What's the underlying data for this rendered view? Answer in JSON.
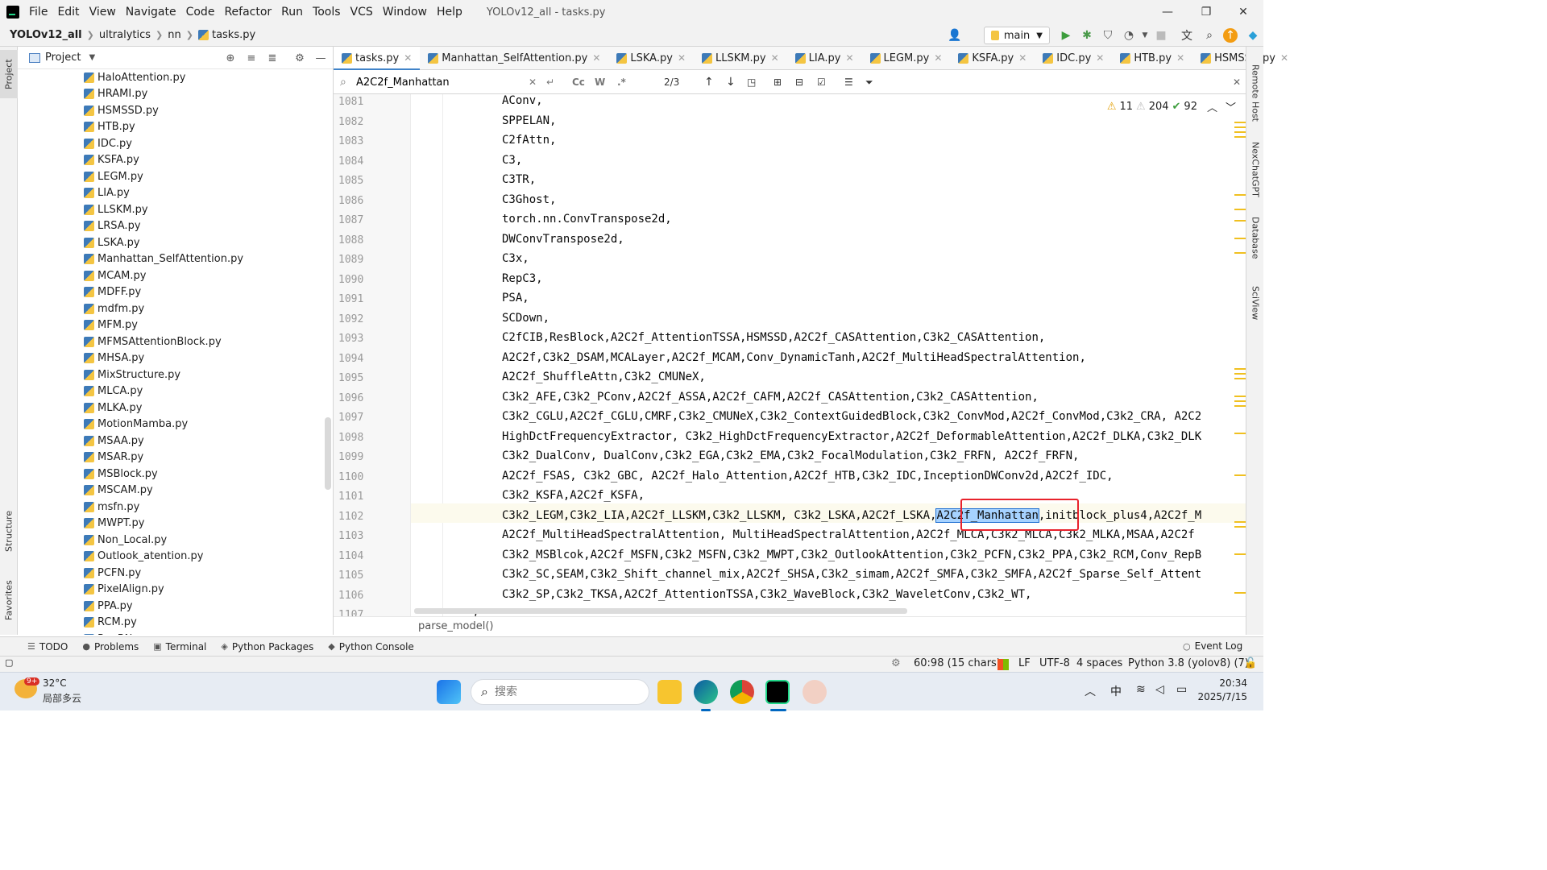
{
  "menubar": {
    "items": [
      "File",
      "Edit",
      "View",
      "Navigate",
      "Code",
      "Refactor",
      "Run",
      "Tools",
      "VCS",
      "Window",
      "Help"
    ],
    "window_title": "YOLOv12_all - tasks.py",
    "minimize": "—",
    "restore": "❐",
    "close": "✕"
  },
  "navbar": {
    "breadcrumb": [
      "YOLOv12_all",
      "ultralytics",
      "nn",
      "tasks.py"
    ],
    "branch": "main"
  },
  "project": {
    "title": "Project",
    "files": [
      "HaloAttention.py",
      "HRAMI.py",
      "HSMSSD.py",
      "HTB.py",
      "IDC.py",
      "KSFA.py",
      "LEGM.py",
      "LIA.py",
      "LLSKM.py",
      "LRSA.py",
      "LSKA.py",
      "Manhattan_SelfAttention.py",
      "MCAM.py",
      "MDFF.py",
      "mdfm.py",
      "MFM.py",
      "MFMSAttentionBlock.py",
      "MHSA.py",
      "MixStructure.py",
      "MLCA.py",
      "MLKA.py",
      "MotionMamba.py",
      "MSAA.py",
      "MSAR.py",
      "MSBlock.py",
      "MSCAM.py",
      "msfn.py",
      "MWPT.py",
      "Non_Local.py",
      "Outlook_atention.py",
      "PCFN.py",
      "PixelAlign.py",
      "PPA.py",
      "RCM.py",
      "RepBN..."
    ]
  },
  "left_stripe": {
    "project": "Project",
    "structure": "Structure",
    "favorites": "Favorites"
  },
  "tabs": [
    "tasks.py",
    "Manhattan_SelfAttention.py",
    "LSKA.py",
    "LLSKM.py",
    "LIA.py",
    "LEGM.py",
    "KSFA.py",
    "IDC.py",
    "HTB.py",
    "HSMSSD.py"
  ],
  "search": {
    "query": "A2C2f_Manhattan",
    "match_case": "Cc",
    "words": "W",
    "regex": ".*",
    "result": "2/3"
  },
  "editor": {
    "inspections": {
      "warnings": "11",
      "weak_warnings": "204",
      "ok": "92"
    },
    "lines": [
      {
        "no": "1081",
        "code": "AConv,"
      },
      {
        "no": "1082",
        "code": "SPPELAN,"
      },
      {
        "no": "1083",
        "code": "C2fAttn,"
      },
      {
        "no": "1084",
        "code": "C3,"
      },
      {
        "no": "1085",
        "code": "C3TR,"
      },
      {
        "no": "1086",
        "code": "C3Ghost,"
      },
      {
        "no": "1087",
        "code": "torch.nn.ConvTranspose2d,"
      },
      {
        "no": "1088",
        "code": "DWConvTranspose2d,"
      },
      {
        "no": "1089",
        "code": "C3x,"
      },
      {
        "no": "1090",
        "code": "RepC3,"
      },
      {
        "no": "1091",
        "code": "PSA,"
      },
      {
        "no": "1092",
        "code": "SCDown,"
      },
      {
        "no": "1093",
        "code": "C2fCIB,ResBlock,A2C2f_AttentionTSSA,HSMSSD,A2C2f_CASAttention,C3k2_CASAttention,"
      },
      {
        "no": "1094",
        "code": "A2C2f,C3k2_DSAM,MCALayer,A2C2f_MCAM,Conv_DynamicTanh,A2C2f_MultiHeadSpectralAttention,"
      },
      {
        "no": "1095",
        "code": "A2C2f_ShuffleAttn,C3k2_CMUNeX,"
      },
      {
        "no": "1096",
        "code": "C3k2_AFE,C3k2_PConv,A2C2f_ASSA,A2C2f_CAFM,A2C2f_CASAttention,C3k2_CASAttention,"
      },
      {
        "no": "1097",
        "code": "C3k2_CGLU,A2C2f_CGLU,CMRF,C3k2_CMUNeX,C3k2_ContextGuidedBlock,C3k2_ConvMod,A2C2f_ConvMod,C3k2_CRA, A2C2"
      },
      {
        "no": "1098",
        "code": "HighDctFrequencyExtractor, C3k2_HighDctFrequencyExtractor,A2C2f_DeformableAttention,A2C2f_DLKA,C3k2_DLK"
      },
      {
        "no": "1099",
        "code": "C3k2_DualConv, DualConv,C3k2_EGA,C3k2_EMA,C3k2_FocalModulation,C3k2_FRFN, A2C2f_FRFN,"
      },
      {
        "no": "1100",
        "code": "A2C2f_FSAS, C3k2_GBC, A2C2f_Halo_Attention,A2C2f_HTB,C3k2_IDC,InceptionDWConv2d,A2C2f_IDC,"
      },
      {
        "no": "1101",
        "code": "C3k2_KSFA,A2C2f_KSFA,"
      },
      {
        "no": "1102",
        "code_before": "C3k2_LEGM,C3k2_LIA,A2C2f_LLSKM,C3k2_LLSKM, C3k2_LSKA,A2C2f_LSKA,",
        "code_match": "A2C2f_Manhattan",
        "code_after": ",initblock_plus4,A2C2f_M"
      },
      {
        "no": "1103",
        "code": "A2C2f_MultiHeadSpectralAttention, MultiHeadSpectralAttention,A2C2f_MLCA,C3k2_MLCA,C3k2_MLKA,MSAA,A2C2f"
      },
      {
        "no": "1104",
        "code": "C3k2_MSBlcok,A2C2f_MSFN,C3k2_MSFN,C3k2_MWPT,C3k2_OutlookAttention,C3k2_PCFN,C3k2_PPA,C3k2_RCM,Conv_RepB"
      },
      {
        "no": "1105",
        "code": "C3k2_SC,SEAM,C3k2_Shift_channel_mix,A2C2f_SHSA,C3k2_simam,A2C2f_SMFA,C3k2_SMFA,A2C2f_Sparse_Self_Attent"
      },
      {
        "no": "1106",
        "code": "C3k2_SP,C3k2_TKSA,A2C2f_AttentionTSSA,C3k2_WaveBlock,C3k2_WaveletConv,C3k2_WT,"
      },
      {
        "no": "1107",
        "code": "}"
      }
    ],
    "method_crumb": "parse_model()"
  },
  "right_stripe": [
    "Remote Host",
    "NexChatGPT",
    "Database",
    "SciView"
  ],
  "tool_windows": [
    "TODO",
    "Problems",
    "Terminal",
    "Python Packages",
    "Python Console"
  ],
  "event_log": "Event Log",
  "status": {
    "position": "60:98 (15 chars)",
    "line_sep": "LF",
    "encoding": "UTF-8",
    "indent": "4 spaces",
    "interpreter": "Python 3.8 (yolov8) (7)"
  },
  "taskbar": {
    "temp": "32°C",
    "weather": "局部多云",
    "weather_badge": "9+",
    "search_placeholder": "搜索",
    "ime": "中",
    "time": "20:34",
    "date": "2025/7/15"
  }
}
